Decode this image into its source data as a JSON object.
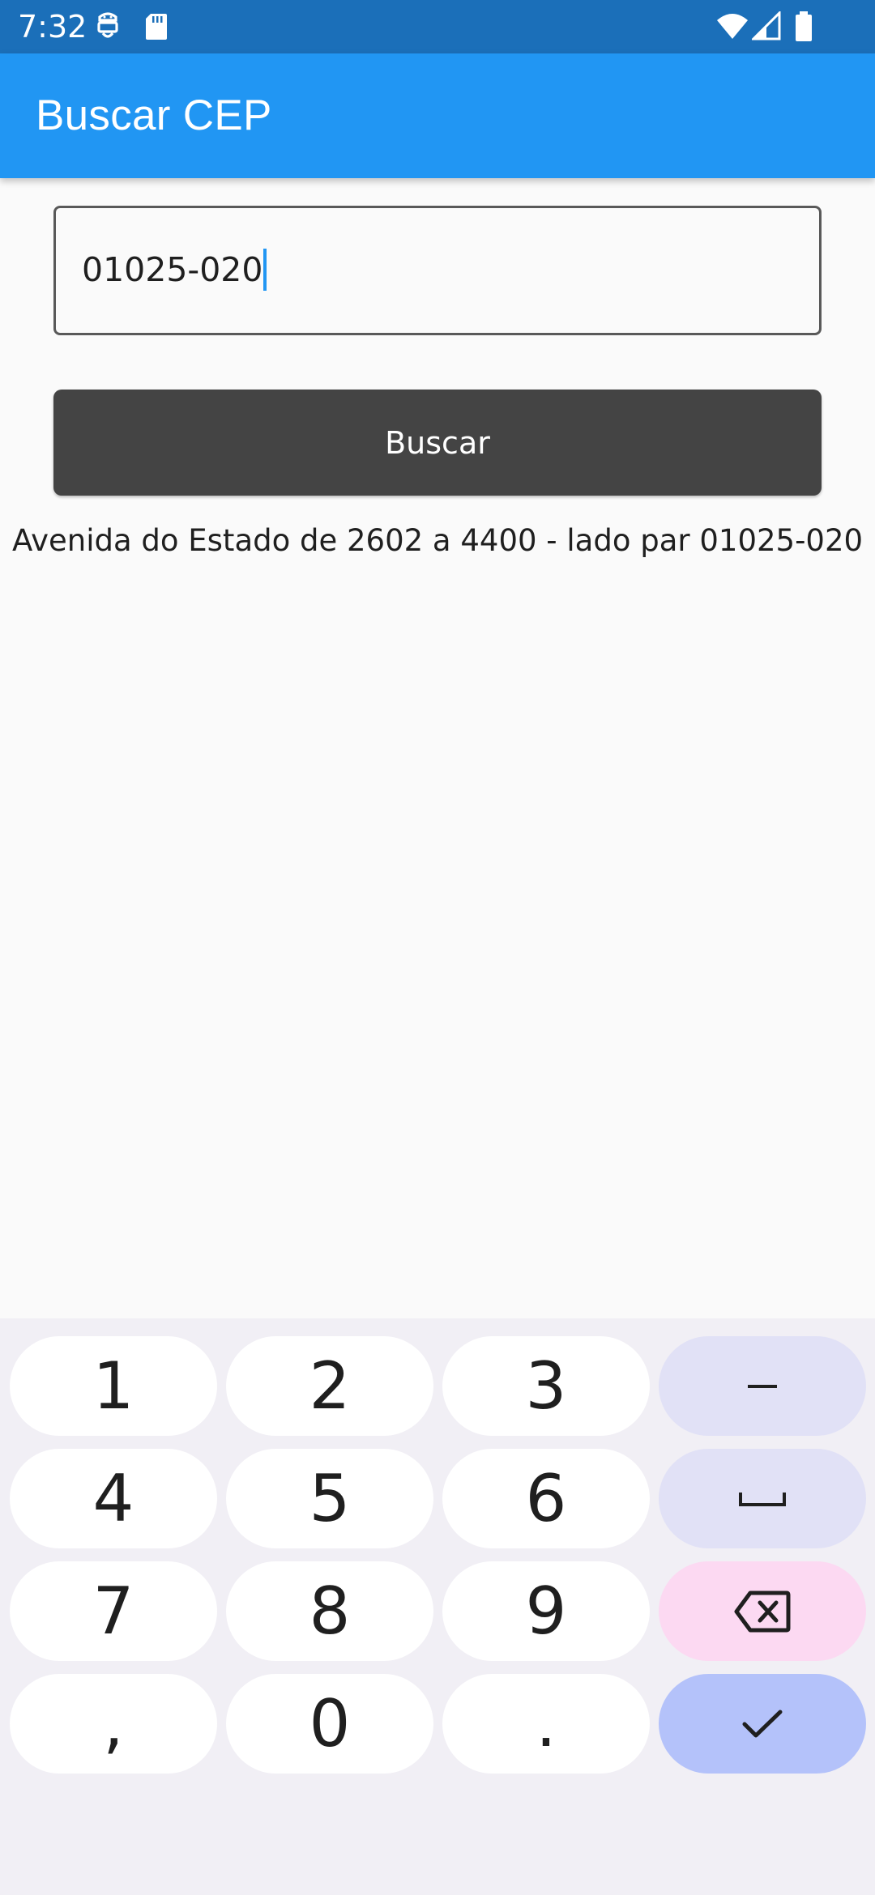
{
  "status_bar": {
    "time": "7:32",
    "left_icons": [
      "android-robot-icon",
      "sd-card-icon"
    ],
    "right_icons": [
      "wifi-icon",
      "cell-signal-icon",
      "battery-icon"
    ]
  },
  "app_bar": {
    "title": "Buscar CEP"
  },
  "form": {
    "cep_value": "01025-020",
    "search_label": "Buscar"
  },
  "result": {
    "text": "Avenida do Estado de 2602 a 4400 - lado par 01025-020"
  },
  "keyboard": {
    "type": "numeric",
    "rows": [
      [
        "1",
        "2",
        "3",
        "–"
      ],
      [
        "4",
        "5",
        "6",
        "␣"
      ],
      [
        "7",
        "8",
        "9",
        "⌫"
      ],
      [
        ",",
        "0",
        ".",
        "✓"
      ]
    ],
    "key_icons": {
      "dash": "dash-icon",
      "space": "space-bar-icon",
      "backspace": "backspace-icon",
      "done": "checkmark-icon"
    },
    "colors": {
      "keyboard_bg": "#f1eff5",
      "number_key": "#ffffff",
      "function_key": "#e1e1f6",
      "backspace_key": "#fcd9f2",
      "done_key": "#b4c2fa"
    }
  },
  "colors": {
    "status_bar": "#1b6fb9",
    "app_bar": "#2196f3",
    "button": "#444444",
    "caret": "#2196f3"
  }
}
